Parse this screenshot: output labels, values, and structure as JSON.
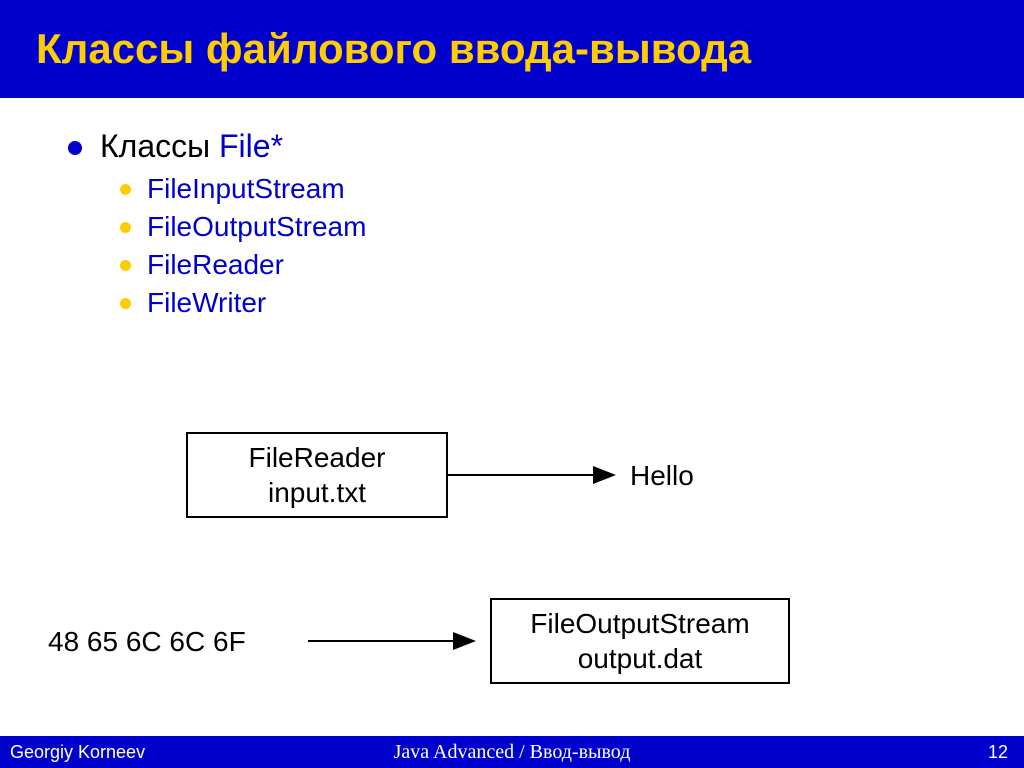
{
  "title": "Классы файлового ввода-вывода",
  "main": {
    "prefix": "Классы ",
    "suffix": "File*"
  },
  "subitems": [
    "FileInputStream",
    "FileOutputStream",
    "FileReader",
    "FileWriter"
  ],
  "diagram1": {
    "box_line1": "FileReader",
    "box_line2": "input.txt",
    "output": "Hello"
  },
  "diagram2": {
    "input": "48 65 6C 6C 6F",
    "box_line1": "FileOutputStream",
    "box_line2": "output.dat"
  },
  "footer": {
    "author": "Georgiy Korneev",
    "center": "Java Advanced / Ввод-вывод",
    "page": "12"
  }
}
